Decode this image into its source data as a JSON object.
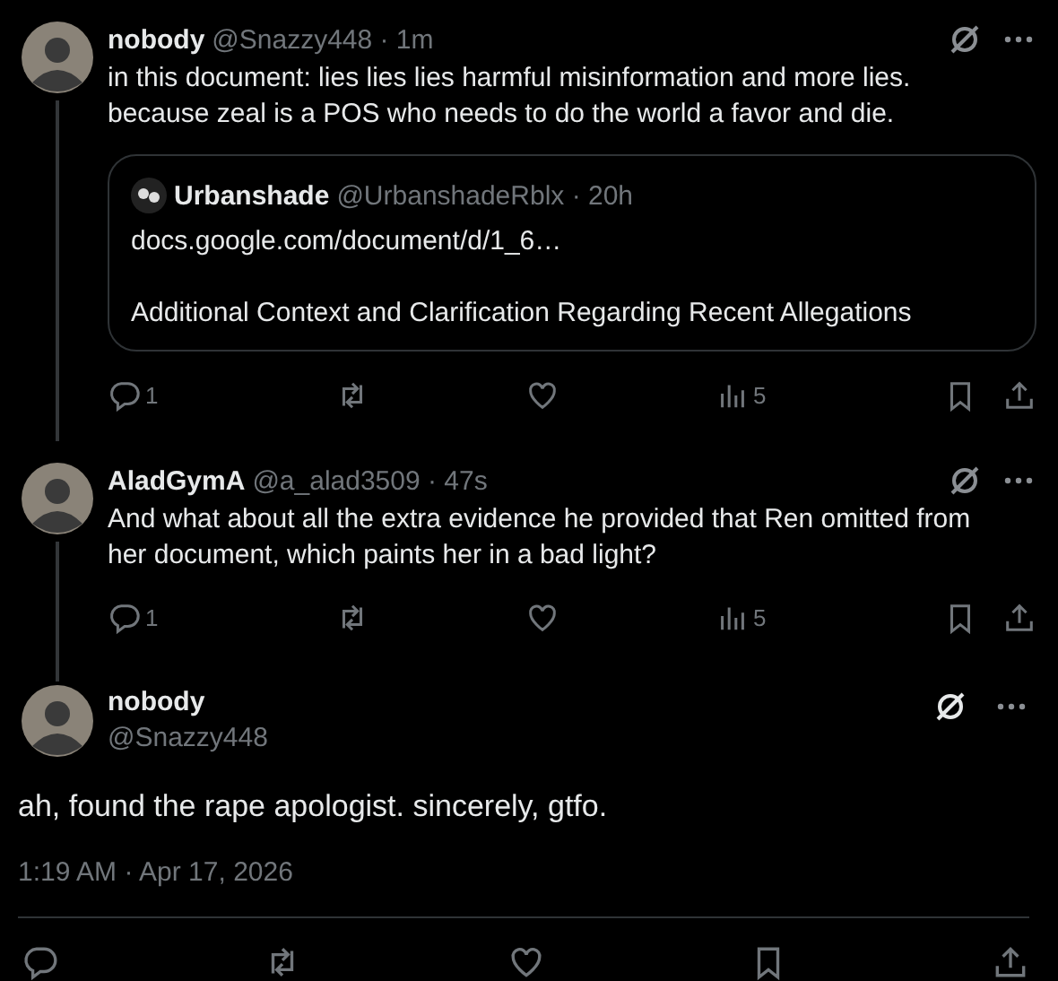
{
  "thread": [
    {
      "name": "nobody",
      "meta": "@Snazzy448 · 1m",
      "text": "in this document: lies lies lies harmful misinformation and more lies. because zeal is a POS who needs to do the world a favor and die.",
      "quote": {
        "name": "Urbanshade",
        "meta": "@UrbanshadeRblx · 20h",
        "link": "docs.google.com/document/d/1_6…",
        "title": "Additional Context and Clarification Regarding Recent Allegations"
      },
      "replies": "1",
      "views": "5"
    },
    {
      "name": "AladGymA",
      "meta": "@a_alad3509 · 47s",
      "text": "And what about all the extra evidence he provided that Ren omitted from her document, which paints her in a bad light?",
      "replies": "1",
      "views": "5"
    }
  ],
  "main": {
    "name": "nobody",
    "handle": "@Snazzy448",
    "text": "ah, found the rape apologist. sincerely, gtfo.",
    "timestamp": "1:19 AM · Apr 17, 2026"
  }
}
